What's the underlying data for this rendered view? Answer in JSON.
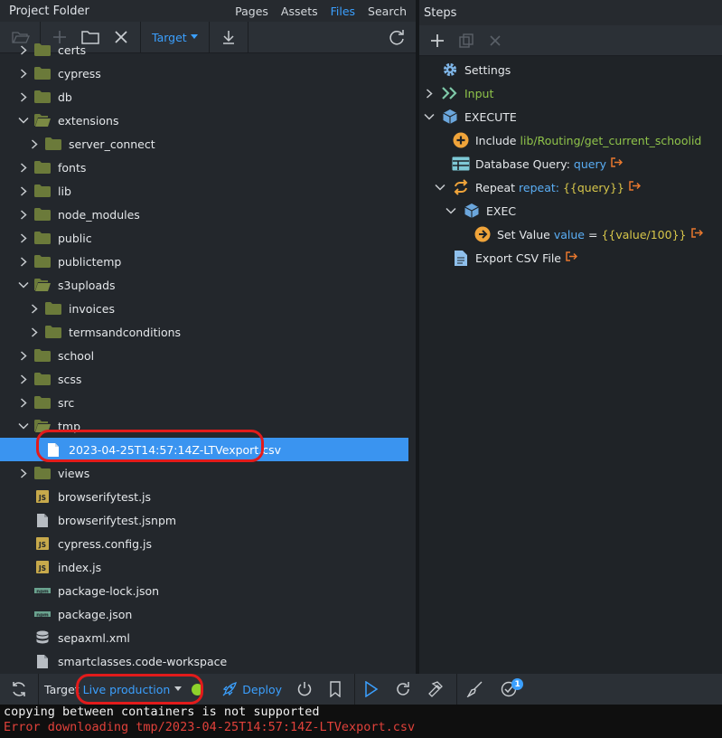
{
  "left_panel": {
    "title": "Project Folder",
    "tabs": [
      {
        "label": "Pages"
      },
      {
        "label": "Assets"
      },
      {
        "label": "Files",
        "active": true
      },
      {
        "label": "Search"
      }
    ],
    "toolbar": {
      "target_label": "Target"
    }
  },
  "tree": [
    {
      "label": "certs",
      "type": "folder",
      "depth": 0,
      "expanded": false,
      "partial": true
    },
    {
      "label": "cypress",
      "type": "folder",
      "depth": 0,
      "expanded": false
    },
    {
      "label": "db",
      "type": "folder",
      "depth": 0,
      "expanded": false
    },
    {
      "label": "extensions",
      "type": "folder",
      "depth": 0,
      "expanded": true
    },
    {
      "label": "server_connect",
      "type": "folder",
      "depth": 1,
      "expanded": false
    },
    {
      "label": "fonts",
      "type": "folder",
      "depth": 0,
      "expanded": false
    },
    {
      "label": "lib",
      "type": "folder",
      "depth": 0,
      "expanded": false
    },
    {
      "label": "node_modules",
      "type": "folder",
      "depth": 0,
      "expanded": false
    },
    {
      "label": "public",
      "type": "folder",
      "depth": 0,
      "expanded": false
    },
    {
      "label": "publictemp",
      "type": "folder",
      "depth": 0,
      "expanded": false
    },
    {
      "label": "s3uploads",
      "type": "folder",
      "depth": 0,
      "expanded": true
    },
    {
      "label": "invoices",
      "type": "folder",
      "depth": 1,
      "expanded": false
    },
    {
      "label": "termsandconditions",
      "type": "folder",
      "depth": 1,
      "expanded": false
    },
    {
      "label": "school",
      "type": "folder",
      "depth": 0,
      "expanded": false
    },
    {
      "label": "scss",
      "type": "folder",
      "depth": 0,
      "expanded": false
    },
    {
      "label": "src",
      "type": "folder",
      "depth": 0,
      "expanded": false
    },
    {
      "label": "tmp",
      "type": "folder",
      "depth": 0,
      "expanded": true
    },
    {
      "label": "2023-04-25T14:57:14Z-LTVexport.csv",
      "type": "file",
      "depth": 1,
      "selected": true
    },
    {
      "label": "views",
      "type": "folder",
      "depth": 0,
      "expanded": false
    },
    {
      "label": "browserifytest.js",
      "type": "js",
      "depth": 0
    },
    {
      "label": "browserifytest.jsnpm",
      "type": "file",
      "depth": 0
    },
    {
      "label": "cypress.config.js",
      "type": "js",
      "depth": 0
    },
    {
      "label": "index.js",
      "type": "js",
      "depth": 0
    },
    {
      "label": "package-lock.json",
      "type": "npm",
      "depth": 0
    },
    {
      "label": "package.json",
      "type": "npm",
      "depth": 0
    },
    {
      "label": "sepaxml.xml",
      "type": "db",
      "depth": 0
    },
    {
      "label": "smartclasses.code-workspace",
      "type": "file",
      "depth": 0
    }
  ],
  "right_panel": {
    "title": "Steps"
  },
  "steps": [
    {
      "depth": 0,
      "chevron": "",
      "icon": "gear",
      "label": "Settings",
      "parts": []
    },
    {
      "depth": 0,
      "chevron": "right",
      "icon": "input",
      "label": "Input",
      "label_color": "green",
      "parts": []
    },
    {
      "depth": 0,
      "chevron": "down",
      "icon": "cube",
      "label": "EXECUTE",
      "parts": []
    },
    {
      "depth": 1,
      "chevron": "",
      "icon": "include",
      "label": "Include",
      "parts": [
        {
          "text": "lib/Routing/get_current_schoolid",
          "color": "green"
        }
      ]
    },
    {
      "depth": 1,
      "chevron": "",
      "icon": "table",
      "label": "Database Query:",
      "parts": [
        {
          "text": "query",
          "color": "blue"
        }
      ],
      "output": true
    },
    {
      "depth": 1,
      "chevron": "down",
      "icon": "repeat",
      "label": "Repeat",
      "parts": [
        {
          "text": "repeat:",
          "color": "blue"
        },
        {
          "text": "{{query}}",
          "color": "yellow"
        }
      ],
      "output": true
    },
    {
      "depth": 2,
      "chevron": "down",
      "icon": "cube",
      "label": "EXEC",
      "parts": []
    },
    {
      "depth": 3,
      "chevron": "",
      "icon": "setvalue",
      "label": "Set Value",
      "parts": [
        {
          "text": "value",
          "color": "blue"
        },
        {
          "text": "=",
          "color": "white"
        },
        {
          "text": "{{value/100}}",
          "color": "yellow"
        }
      ],
      "output": true
    },
    {
      "depth": 1,
      "chevron": "",
      "icon": "doc",
      "label": "Export CSV File",
      "parts": [],
      "output": true
    }
  ],
  "bottom_bar": {
    "target_label": "Target",
    "target_value": "Live production",
    "deploy_label": "Deploy",
    "notification_count": "1"
  },
  "console": {
    "lines": [
      {
        "text": "copying between containers is not supported",
        "level": "info"
      },
      {
        "text": "Error downloading tmp/2023-04-25T14:57:14Z-LTVexport.csv",
        "level": "error"
      }
    ]
  },
  "colors": {
    "accent": "#3ba0ff",
    "selection": "#3a94f0",
    "folder": "#6b7a3a",
    "highlight_box": "#e21b1b",
    "status_dot": "#8ed12b"
  }
}
